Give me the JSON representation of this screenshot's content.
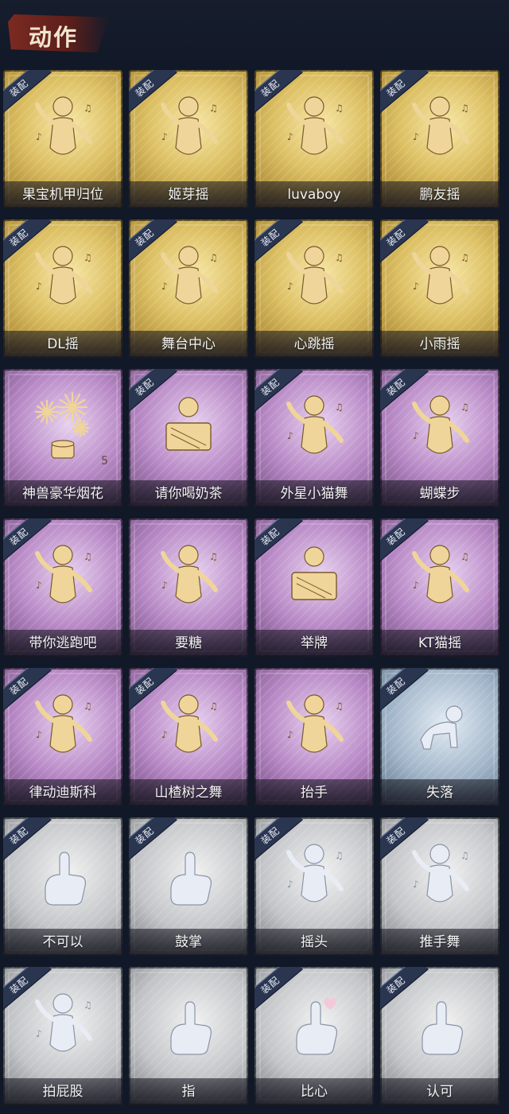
{
  "header": {
    "title": "动作"
  },
  "equip_label": "装配",
  "colors": {
    "gold": "#dcbf62",
    "purple": "#b889c6",
    "blue": "#9fb3c7",
    "gray": "#c2c4c7",
    "silhouette_gold": "#f0d59a",
    "silhouette_gray": "#e8ecf4"
  },
  "cards": [
    {
      "name": "果宝机甲归位",
      "rarity": "gold",
      "equipped": true,
      "icon": "dance-pose-icon"
    },
    {
      "name": "姬芽摇",
      "rarity": "gold",
      "equipped": true,
      "icon": "dance-pose-icon"
    },
    {
      "name": "luvaboy",
      "rarity": "gold",
      "equipped": true,
      "icon": "dance-pose-icon"
    },
    {
      "name": "鹏友摇",
      "rarity": "gold",
      "equipped": true,
      "icon": "dance-pose-icon"
    },
    {
      "name": "DL摇",
      "rarity": "gold",
      "equipped": true,
      "icon": "dance-pose-icon"
    },
    {
      "name": "舞台中心",
      "rarity": "gold",
      "equipped": true,
      "icon": "dance-pose-icon"
    },
    {
      "name": "心跳摇",
      "rarity": "gold",
      "equipped": true,
      "icon": "dance-pose-icon"
    },
    {
      "name": "小雨摇",
      "rarity": "gold",
      "equipped": true,
      "icon": "dance-pose-icon"
    },
    {
      "name": "神兽豪华烟花",
      "rarity": "purple",
      "equipped": false,
      "icon": "fireworks-icon",
      "count": "5"
    },
    {
      "name": "请你喝奶茶",
      "rarity": "purple",
      "equipped": true,
      "icon": "milk-tea-sign-icon"
    },
    {
      "name": "外星小猫舞",
      "rarity": "purple",
      "equipped": true,
      "icon": "dance-pose-icon"
    },
    {
      "name": "蝴蝶步",
      "rarity": "purple",
      "equipped": true,
      "icon": "dance-pose-icon"
    },
    {
      "name": "带你逃跑吧",
      "rarity": "purple",
      "equipped": true,
      "icon": "dance-pose-icon"
    },
    {
      "name": "要糖",
      "rarity": "purple",
      "equipped": false,
      "icon": "ask-candy-pose-icon"
    },
    {
      "name": "举牌",
      "rarity": "purple",
      "equipped": true,
      "icon": "hold-sign-icon"
    },
    {
      "name": "KT猫摇",
      "rarity": "purple",
      "equipped": true,
      "icon": "dance-pose-icon"
    },
    {
      "name": "律动迪斯科",
      "rarity": "purple",
      "equipped": true,
      "icon": "disco-pose-icon"
    },
    {
      "name": "山楂树之舞",
      "rarity": "purple",
      "equipped": true,
      "icon": "dance-pose-icon"
    },
    {
      "name": "抬手",
      "rarity": "purple",
      "equipped": false,
      "icon": "raise-hand-icon"
    },
    {
      "name": "失落",
      "rarity": "blue",
      "equipped": true,
      "icon": "crawling-pose-icon"
    },
    {
      "name": "不可以",
      "rarity": "gray",
      "equipped": true,
      "icon": "wagging-finger-icon"
    },
    {
      "name": "鼓掌",
      "rarity": "gray",
      "equipped": true,
      "icon": "clapping-hands-icon"
    },
    {
      "name": "摇头",
      "rarity": "gray",
      "equipped": true,
      "icon": "shake-head-icon"
    },
    {
      "name": "推手舞",
      "rarity": "gray",
      "equipped": true,
      "icon": "push-hands-icon"
    },
    {
      "name": "拍屁股",
      "rarity": "gray",
      "equipped": true,
      "icon": "pat-pose-icon"
    },
    {
      "name": "指",
      "rarity": "gray",
      "equipped": false,
      "icon": "pointing-hand-icon"
    },
    {
      "name": "比心",
      "rarity": "gray",
      "equipped": true,
      "icon": "finger-heart-icon"
    },
    {
      "name": "认可",
      "rarity": "gray",
      "equipped": true,
      "icon": "thumbs-up-icon"
    }
  ]
}
